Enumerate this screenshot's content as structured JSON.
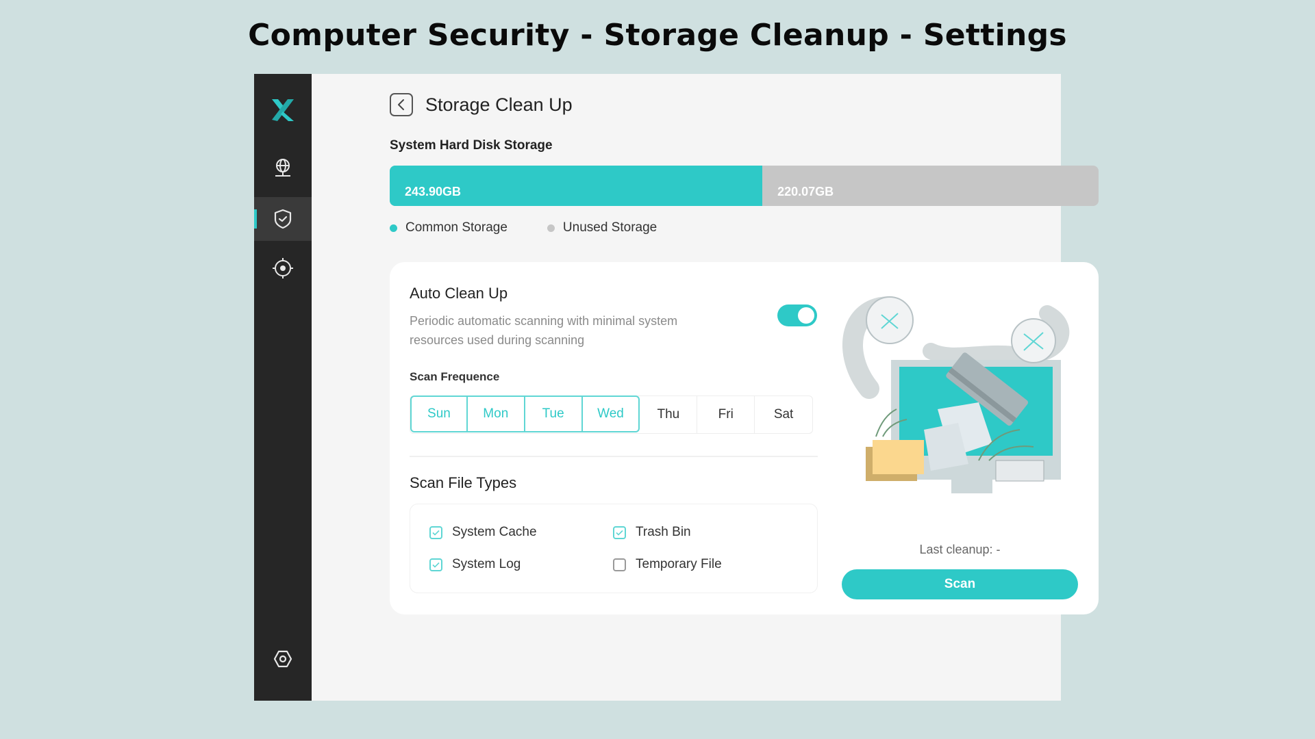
{
  "page_title": "Computer Security - Storage Cleanup - Settings",
  "colors": {
    "accent": "#2ec9c7",
    "unused": "#c6c6c6",
    "sidebar": "#262626"
  },
  "sidebar": {
    "logo": "x-logo-icon",
    "items": [
      {
        "name": "network",
        "icon": "globe-network-icon",
        "active": false
      },
      {
        "name": "security",
        "icon": "shield-check-icon",
        "active": true
      },
      {
        "name": "scan",
        "icon": "crosshair-target-icon",
        "active": false
      }
    ],
    "bottom_item": {
      "name": "settings",
      "icon": "hex-nut-settings-icon"
    }
  },
  "header": {
    "back_icon": "chevron-left-icon",
    "title": "Storage Clean Up"
  },
  "storage": {
    "label": "System Hard Disk Storage",
    "used_value": "243.90GB",
    "unused_value": "220.07GB",
    "used_fraction": 0.5257,
    "legend": [
      {
        "label": "Common Storage",
        "color": "#2ec9c7"
      },
      {
        "label": "Unused Storage",
        "color": "#c6c6c6"
      }
    ]
  },
  "auto_cleanup": {
    "title": "Auto Clean Up",
    "description": "Periodic automatic scanning with minimal system resources used during scanning",
    "enabled": true
  },
  "scan_frequency": {
    "label": "Scan Frequence",
    "days": [
      {
        "label": "Sun",
        "selected": true
      },
      {
        "label": "Mon",
        "selected": true
      },
      {
        "label": "Tue",
        "selected": true
      },
      {
        "label": "Wed",
        "selected": true
      },
      {
        "label": "Thu",
        "selected": false
      },
      {
        "label": "Fri",
        "selected": false
      },
      {
        "label": "Sat",
        "selected": false
      }
    ]
  },
  "file_types": {
    "title": "Scan File Types",
    "items": [
      {
        "label": "System Cache",
        "checked": true
      },
      {
        "label": "Trash Bin",
        "checked": true
      },
      {
        "label": "System Log",
        "checked": true
      },
      {
        "label": "Temporary File",
        "checked": false
      }
    ]
  },
  "illustration": "vacuum-cleaning-computer-illustration",
  "last_cleanup": "Last cleanup: -",
  "scan_button": "Scan"
}
